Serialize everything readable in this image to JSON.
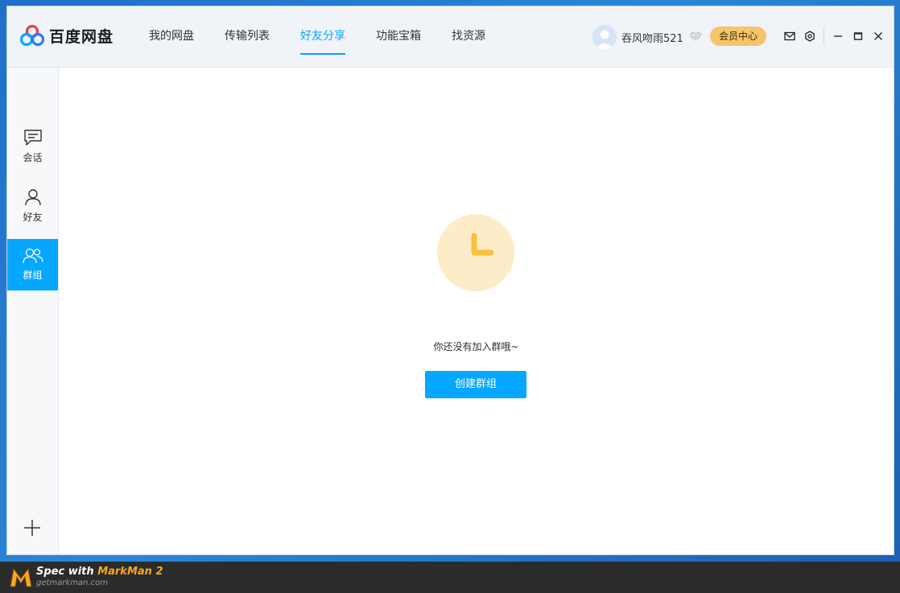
{
  "app": {
    "name": "百度网盘"
  },
  "nav": {
    "items": [
      {
        "label": "我的网盘"
      },
      {
        "label": "传输列表"
      },
      {
        "label": "好友分享"
      },
      {
        "label": "功能宝箱"
      },
      {
        "label": "找资源"
      }
    ],
    "active_index": 2
  },
  "user": {
    "name": "吞风吻雨521",
    "vip_label": "会员中心"
  },
  "sidebar": {
    "items": [
      {
        "label": "会话",
        "icon": "chat-icon"
      },
      {
        "label": "好友",
        "icon": "person-icon"
      },
      {
        "label": "群组",
        "icon": "group-icon"
      }
    ],
    "active_index": 2,
    "add_icon": "plus-icon"
  },
  "main": {
    "empty_text": "你还没有加入群哦~",
    "create_button": "创建群组"
  },
  "markman": {
    "prefix": "Spec with ",
    "brand": "MarkMan 2",
    "site": "getmarkman.com"
  },
  "colors": {
    "accent": "#06a7ff",
    "vip": "#f5c56b",
    "empty_circle": "#fdecc8",
    "clock_hand": "#f8c23a"
  }
}
